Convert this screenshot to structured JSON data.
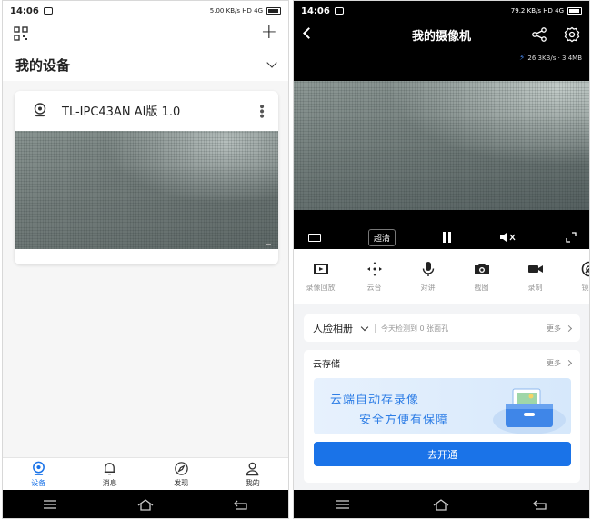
{
  "left": {
    "status": {
      "time": "14:06",
      "indicators": "5.00 KB/s HD 4G"
    },
    "header": {
      "scan_icon": "qr-scan-icon",
      "add_icon": "plus-icon"
    },
    "title": "我的设备",
    "device": {
      "name": "TL-IPC43AN AI版 1.0",
      "icon": "camera-icon"
    },
    "tabs": [
      {
        "label": "设备",
        "icon": "device-icon",
        "active": true
      },
      {
        "label": "消息",
        "icon": "bell-icon",
        "active": false
      },
      {
        "label": "发现",
        "icon": "compass-icon",
        "active": false
      },
      {
        "label": "我的",
        "icon": "person-icon",
        "active": false
      }
    ]
  },
  "right": {
    "status": {
      "time": "14:06",
      "indicators": "79.2 KB/s HD 4G"
    },
    "title": "我的摄像机",
    "speed": "26.3KB/s · 3.4MB",
    "controls": {
      "quality": "超清"
    },
    "tools": [
      {
        "label": "录像回放",
        "icon": "film-icon"
      },
      {
        "label": "云台",
        "icon": "move-arrows-icon"
      },
      {
        "label": "对讲",
        "icon": "microphone-icon"
      },
      {
        "label": "截图",
        "icon": "camera-snapshot-icon"
      },
      {
        "label": "录制",
        "icon": "video-record-icon"
      },
      {
        "label": "镜头",
        "icon": "lens-icon"
      }
    ],
    "face": {
      "title": "人脸相册",
      "info": "今天检测到 0 张面孔",
      "more": "更多"
    },
    "cloud": {
      "title": "云存储",
      "more": "更多",
      "banner_line1": "云端自动存录像",
      "banner_line2": "安全方便有保障",
      "button": "去开通"
    }
  },
  "colors": {
    "accent": "#1a73e8",
    "banner_text": "#2e7ee6"
  }
}
